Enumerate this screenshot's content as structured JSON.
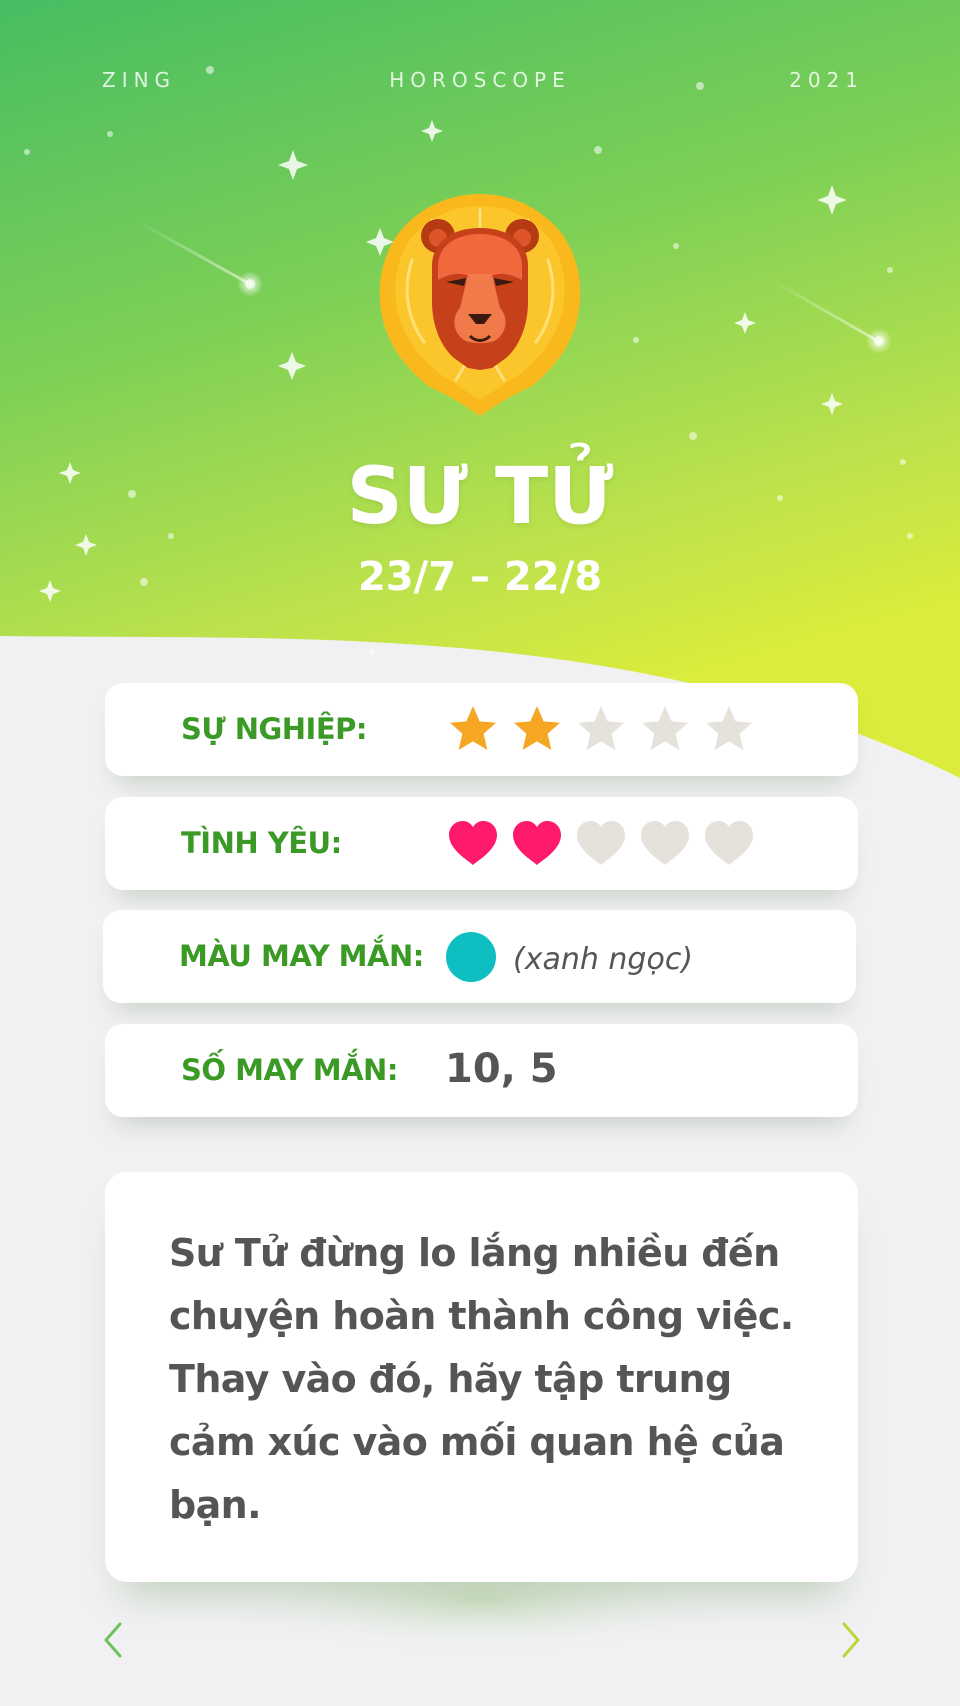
{
  "header": {
    "left": "ZING",
    "center": "HOROSCOPE",
    "right": "2021"
  },
  "sign": {
    "name": "SƯ TỬ",
    "dates": "23/7 – 22/8",
    "icon": "lion-icon"
  },
  "career": {
    "label": "SỰ NGHIỆP:",
    "rating": 2,
    "max": 5,
    "icon": "star-icon"
  },
  "love": {
    "label": "TÌNH YÊU:",
    "rating": 2,
    "max": 5,
    "icon": "heart-icon"
  },
  "lucky_color": {
    "label": "MÀU MAY MẮN:",
    "swatch": "#0ebfc2",
    "name": "(xanh ngọc)"
  },
  "lucky_number": {
    "label": "SỐ MAY MẮN:",
    "value": "10, 5"
  },
  "message": {
    "text": "Sư Tử đừng lo lắng nhiều đến chuyện hoàn thành công việc. Thay vào đó, hãy tập trung cảm xúc vào mối quan hệ của bạn."
  },
  "navigation": {
    "prev_icon": "chevron-left-icon",
    "next_icon": "chevron-right-icon"
  },
  "colors": {
    "green_top": "#47bd62",
    "green_mid": "#7fd056",
    "lime": "#dbec3c",
    "label_green": "#3a9a25",
    "star_active": "#f5a623",
    "heart_active": "#ff1a6b",
    "inactive": "#e5e2dc",
    "background": "#f1f1f3"
  }
}
